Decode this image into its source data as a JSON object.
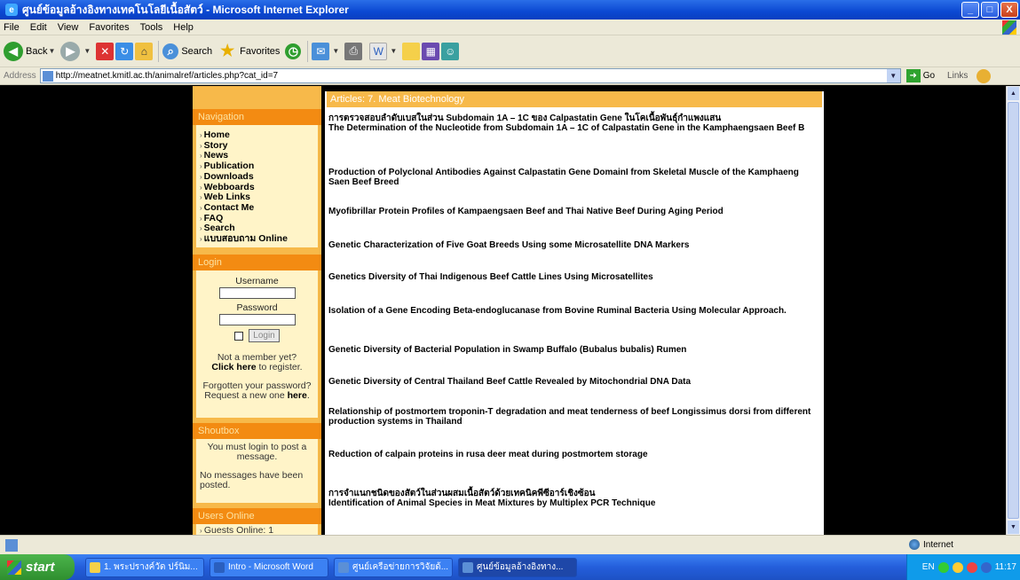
{
  "window": {
    "title": "ศูนย์ข้อมูลอ้างอิงทางเทคโนโลยีเนื้อสัตว์ - Microsoft Internet Explorer",
    "min": "_",
    "max": "□",
    "close": "X"
  },
  "menu": [
    "File",
    "Edit",
    "View",
    "Favorites",
    "Tools",
    "Help"
  ],
  "toolbar": {
    "back": "Back",
    "search": "Search",
    "favorites": "Favorites"
  },
  "address": {
    "label": "Address",
    "url": "http://meatnet.kmitl.ac.th/animalref/articles.php?cat_id=7",
    "go": "Go",
    "links": "Links"
  },
  "sidebar": {
    "navigation_title": "Navigation",
    "nav_items": [
      "Home",
      "Story",
      "News",
      "Publication",
      "Downloads",
      "Webboards",
      "Web Links",
      "Contact Me",
      "FAQ",
      "Search",
      "แบบสอบถาม Online"
    ],
    "login_title": "Login",
    "username_label": "Username",
    "password_label": "Password",
    "login_button": "Login",
    "not_member": "Not a member yet?",
    "click_here": "Click here",
    "to_register": " to register.",
    "forgotten": "Forgotten your password?",
    "request_new": "Request a new one ",
    "here": "here",
    "period": ".",
    "shoutbox_title": "Shoutbox",
    "shoutbox_login": "You must login to post a message.",
    "shoutbox_empty": "No messages have been posted.",
    "users_title": "Users Online",
    "guests_online": "Guests Online: 1"
  },
  "content": {
    "heading": "Articles: 7. Meat Biotechnology",
    "articles": [
      "การตรวจสอบลำดับเบสในส่วน Subdomain 1A – 1C ของ Calpastatin Gene ในโคเนื้อพันธุ์กำแพงแสน\nThe Determination of the Nucleotide from Subdomain 1A – 1C of Calpastatin Gene in the Kamphaengsaen Beef B",
      "Production of Polyclonal Antibodies Against Calpastatin Gene DomainI from Skeletal Muscle of the Kamphaeng Saen Beef Breed",
      "Myofibrillar Protein Profiles of Kampaengsaen Beef and Thai Native Beef During Aging Period",
      "Genetic Characterization of Five Goat Breeds Using some Microsatellite DNA Markers",
      "Genetics Diversity of Thai Indigenous Beef Cattle Lines Using Microsatellites",
      "Isolation of a Gene Encoding Beta-endoglucanase from Bovine Ruminal Bacteria Using Molecular Approach.",
      "Genetic Diversity of Bacterial Population in Swamp Buffalo (Bubalus bubalis) Rumen",
      "Genetic Diversity of Central Thailand Beef Cattle Revealed by Mitochondrial DNA Data",
      "Relationship of postmortem troponin-T degradation and meat tenderness of beef Longissimus dorsi from different production systems in Thailand",
      "Reduction of calpain proteins in rusa deer meat during postmortem storage",
      "การจำแนกชนิดของสัตว์ในส่วนผสมเนื้อสัตว์ด้วยเทคนิคพีซีอาร์เชิงซ้อน\nIdentification of Animal Species in Meat Mixtures by Multiplex PCR Technique"
    ]
  },
  "status": {
    "zone": "Internet"
  },
  "taskbar": {
    "start": "start",
    "tasks": [
      "1. พระปรางค์วัด ปร์นิม...",
      "Intro - Microsoft Word",
      "ศูนย์เครือข่ายการวิจัยด้...",
      "ศูนย์ข้อมูลอ้างอิงทาง..."
    ],
    "lang": "EN",
    "clock": "11:17"
  }
}
